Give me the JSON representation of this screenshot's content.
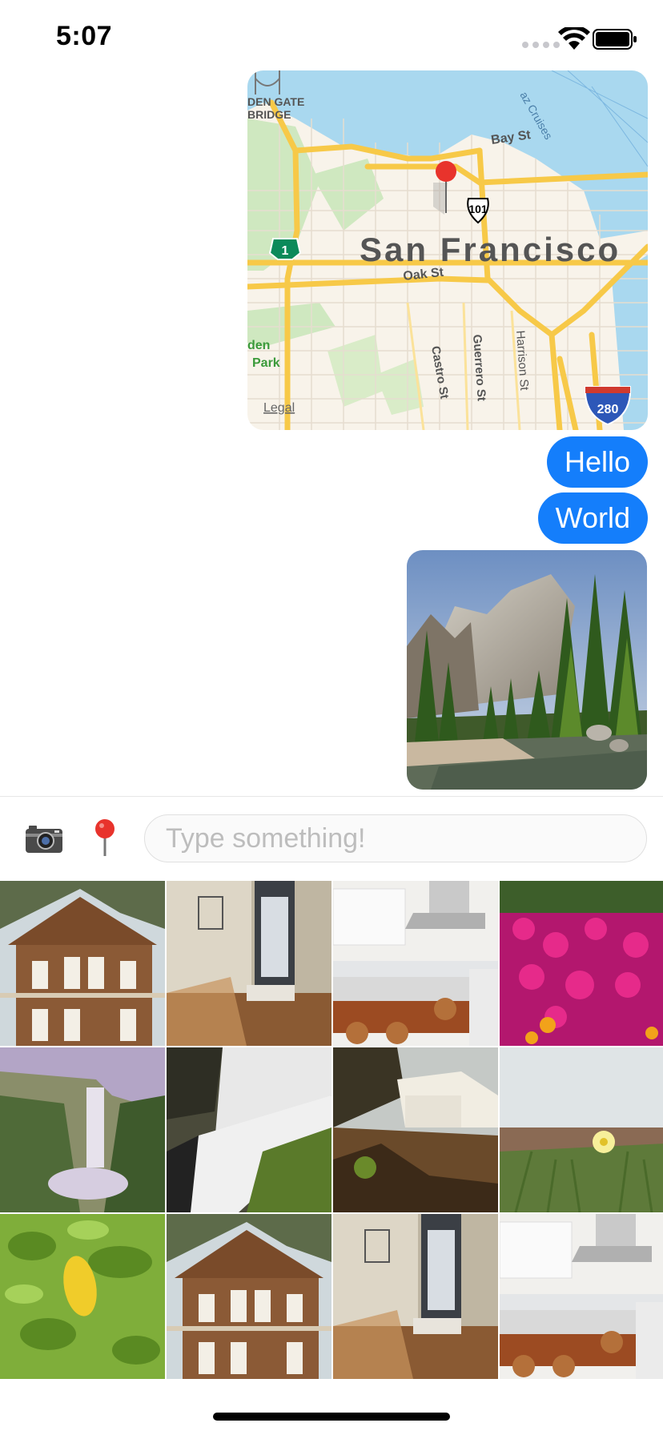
{
  "status_bar": {
    "time": "5:07"
  },
  "map": {
    "city": "San Francisco",
    "labels": [
      "DEN GATE",
      "BRIDGE",
      "Bay St",
      "Oak St",
      "Castro St",
      "Guerrero St",
      "Harrison St",
      "den",
      "Park",
      "Legal"
    ],
    "shields": {
      "us_101": "101",
      "ca_1": "1",
      "i_280": "280"
    },
    "extra_label": "az Cruises"
  },
  "messages": [
    {
      "type": "location"
    },
    {
      "type": "text",
      "text": "Hello"
    },
    {
      "type": "text",
      "text": "World"
    },
    {
      "type": "photo",
      "subject": "mountain-forest-river"
    }
  ],
  "input": {
    "placeholder": "Type something!",
    "value": ""
  },
  "colors": {
    "bubble": "#147efb",
    "map_water": "#a9d8ef",
    "map_land": "#f8f3ea",
    "road": "#f7c948",
    "pin": "#e8332c"
  },
  "grid": {
    "tiles": [
      "house",
      "room-door",
      "kitchen",
      "pink-flowers",
      "waterfall-cliff",
      "waterfall-rocks",
      "waterfall-sunset",
      "yellow-flower",
      "leaves",
      "house",
      "room-door",
      "kitchen"
    ]
  }
}
